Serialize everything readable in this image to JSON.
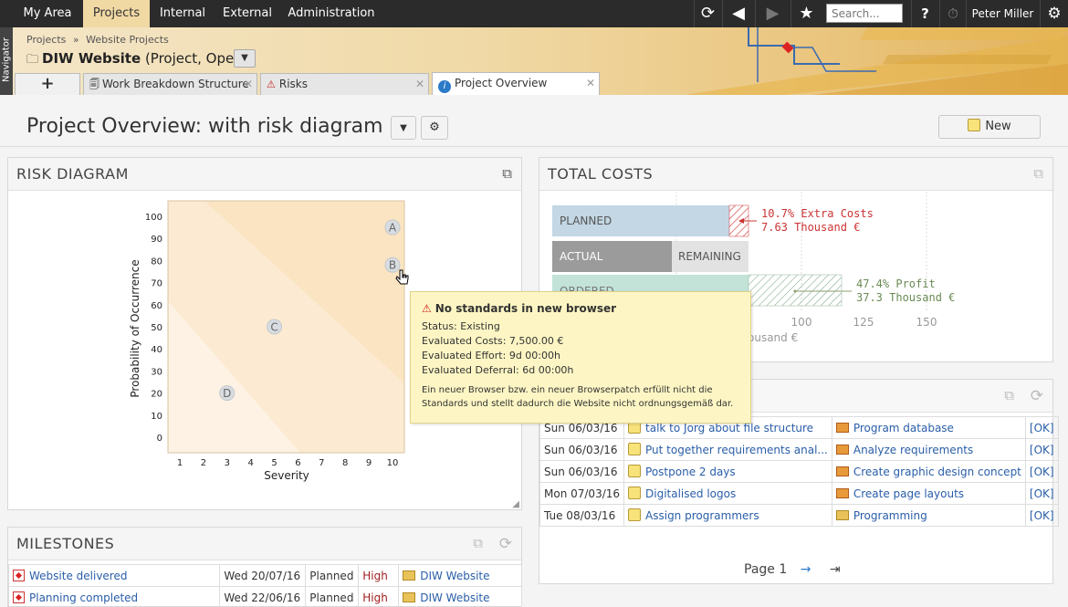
{
  "topnav": {
    "tabs": [
      {
        "label": "My Area"
      },
      {
        "label": "Projects"
      },
      {
        "label": "Internal"
      },
      {
        "label": "External"
      },
      {
        "label": "Administration"
      }
    ],
    "search_placeholder": "Search...",
    "help_label": "?",
    "user_name": "Peter Miller"
  },
  "navigator_label": "Navigator",
  "breadcrumb": {
    "root": "Projects",
    "sep": "»",
    "current": "Website Projects"
  },
  "project": {
    "name": "DIW Website",
    "meta": "(Project, Open)"
  },
  "tabs": [
    {
      "label": "Work Breakdown Structure"
    },
    {
      "label": "Risks"
    },
    {
      "label": "Project Overview"
    }
  ],
  "page": {
    "title": "Project Overview: with risk diagram",
    "new_label": "New"
  },
  "risk": {
    "title": "RISK DIAGRAM",
    "ylabel": "Probability of Occurrence",
    "xlabel": "Severity",
    "yticks": [
      "100",
      "90",
      "80",
      "70",
      "60",
      "50",
      "40",
      "30",
      "20",
      "10",
      "0"
    ],
    "xticks": [
      "1",
      "2",
      "3",
      "4",
      "5",
      "6",
      "7",
      "8",
      "9",
      "10"
    ],
    "points": [
      {
        "label": "A",
        "severity": 10,
        "probability": 95
      },
      {
        "label": "B",
        "severity": 10,
        "probability": 78
      },
      {
        "label": "C",
        "severity": 5,
        "probability": 50
      },
      {
        "label": "D",
        "severity": 3,
        "probability": 20
      }
    ]
  },
  "tooltip": {
    "title": "No standards in new browser",
    "status": "Status: Existing",
    "costs": "Evaluated Costs: 7,500.00 €",
    "effort": "Evaluated Effort: 9d 00:00h",
    "deferral": "Evaluated Deferral: 6d 00:00h",
    "description": "Ein neuer Browser bzw. ein neuer Browserpatch erfüllt nicht die Standards und stellt dadurch die Website nicht ordnungsgemäß dar."
  },
  "costs": {
    "title": "TOTAL COSTS",
    "planned_label": "PLANNED",
    "actual_label": "ACTUAL",
    "remaining_label": "REMAINING",
    "ordered_label": "ORDERED",
    "extra_pct": "10.7% Extra Costs",
    "extra_amt": "7.63 Thousand €",
    "profit_pct": "47.4% Profit",
    "profit_amt": "37.3 Thousand €",
    "axis_ticks": [
      "100",
      "125",
      "150"
    ],
    "axis_unit": "ousand €",
    "colors": {
      "planned": "#c3d7e4",
      "actual": "#9b9b9b",
      "remaining": "#e2e2e2",
      "ordered": "#c3e3d9",
      "extra": "#c33",
      "profit": "#6a8a54"
    }
  },
  "tasks": {
    "rows": [
      {
        "date": "Sun 06/03/16",
        "task": "talk to Jorg about file structure",
        "activity": "Program database",
        "status": "[OK]"
      },
      {
        "date": "Sun 06/03/16",
        "task": "Put together requirements anal...",
        "activity": "Analyze requirements",
        "status": "[OK]"
      },
      {
        "date": "Sun 06/03/16",
        "task": "Postpone 2 days",
        "activity": "Create graphic design concept",
        "status": "[OK]"
      },
      {
        "date": "Mon 07/03/16",
        "task": "Digitalised logos",
        "activity": "Create page layouts",
        "status": "[OK]"
      },
      {
        "date": "Tue 08/03/16",
        "task": "Assign programmers",
        "activity": "Programming",
        "status": "[OK]"
      }
    ],
    "page_label": "Page 1"
  },
  "milestones": {
    "title": "MILESTONES",
    "rows": [
      {
        "name": "Website delivered",
        "date": "Wed 20/07/16",
        "state": "Planned",
        "priority": "High",
        "project": "DIW Website"
      },
      {
        "name": "Planning completed",
        "date": "Wed 22/06/16",
        "state": "Planned",
        "priority": "High",
        "project": "DIW Website"
      }
    ]
  }
}
